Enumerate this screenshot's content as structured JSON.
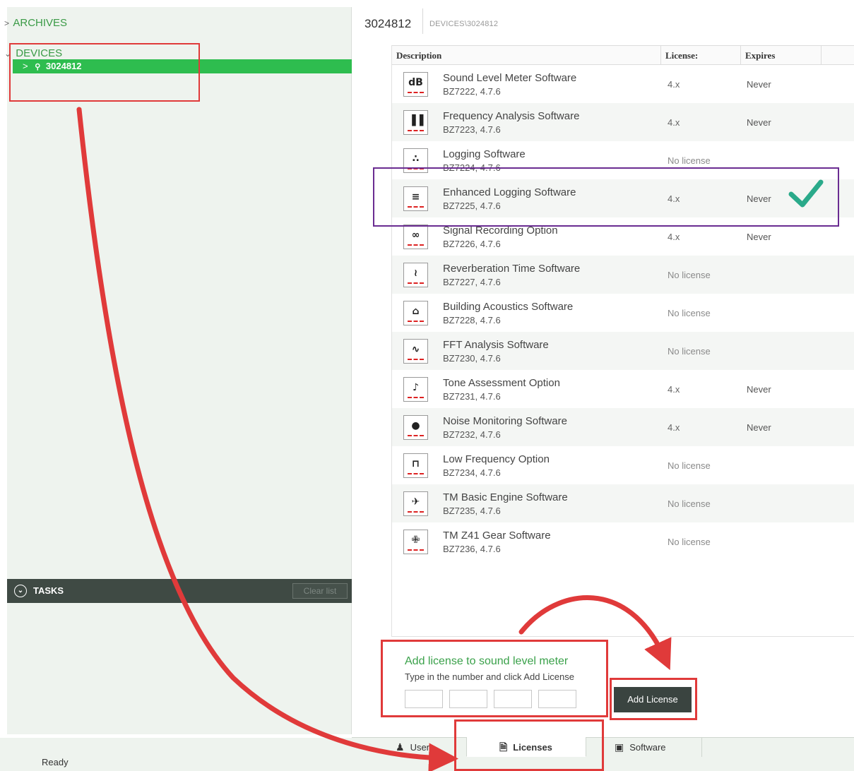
{
  "tree": {
    "archives": "ARCHIVES",
    "devices": "DEVICES",
    "device_id": "3024812"
  },
  "tasks": {
    "label": "TASKS",
    "clear_label": "Clear list"
  },
  "header": {
    "title": "3024812",
    "breadcrumb": "DEVICES\\3024812"
  },
  "table": {
    "columns": [
      "Description",
      "License:",
      "Expires"
    ],
    "rows": [
      {
        "icon": "db-icon",
        "name": "Sound Level Meter Software",
        "code": "BZ7222, 4.7.6",
        "license": "4.x",
        "expires": "Never"
      },
      {
        "icon": "frequency-bars-icon",
        "name": "Frequency Analysis Software",
        "code": "BZ7223, 4.7.6",
        "license": "4.x",
        "expires": "Never"
      },
      {
        "icon": "logging-icon",
        "name": "Logging Software",
        "code": "BZ7224, 4.7.6",
        "license": "No license",
        "expires": ""
      },
      {
        "icon": "enhanced-logging-icon",
        "name": "Enhanced Logging Software",
        "code": "BZ7225, 4.7.6",
        "license": "4.x",
        "expires": "Never"
      },
      {
        "icon": "tape-recording-icon",
        "name": "Signal Recording Option",
        "code": "BZ7226, 4.7.6",
        "license": "4.x",
        "expires": "Never"
      },
      {
        "icon": "reverberation-icon",
        "name": "Reverberation Time Software",
        "code": "BZ7227, 4.7.6",
        "license": "No license",
        "expires": ""
      },
      {
        "icon": "house-icon",
        "name": "Building Acoustics Software",
        "code": "BZ7228, 4.7.6",
        "license": "No license",
        "expires": ""
      },
      {
        "icon": "fft-spectrum-icon",
        "name": "FFT Analysis Software",
        "code": "BZ7230, 4.7.6",
        "license": "No license",
        "expires": ""
      },
      {
        "icon": "music-note-icon",
        "name": "Tone Assessment Option",
        "code": "BZ7231, 4.7.6",
        "license": "4.x",
        "expires": "Never"
      },
      {
        "icon": "noise-monitor-icon",
        "name": "Noise Monitoring Software",
        "code": "BZ7232, 4.7.6",
        "license": "4.x",
        "expires": "Never"
      },
      {
        "icon": "low-frequency-icon",
        "name": "Low Frequency Option",
        "code": "BZ7234, 4.7.6",
        "license": "No license",
        "expires": ""
      },
      {
        "icon": "helicopter-icon",
        "name": "TM Basic Engine Software",
        "code": "BZ7235, 4.7.6",
        "license": "No license",
        "expires": ""
      },
      {
        "icon": "helicopter-gear-icon",
        "name": "TM Z41 Gear Software",
        "code": "BZ7236, 4.7.6",
        "license": "No license",
        "expires": ""
      }
    ]
  },
  "add_license": {
    "title": "Add license to sound level meter",
    "subtitle": "Type in the number and click Add License",
    "button_label": "Add License"
  },
  "tabs": [
    {
      "label": "Users",
      "icon": "user-icon"
    },
    {
      "label": "Licenses",
      "icon": "license-icon"
    },
    {
      "label": "Software",
      "icon": "software-icon"
    }
  ],
  "status": "Ready",
  "colors": {
    "accent_green": "#2ebd4f",
    "annotation_red": "#e03a3a",
    "annotation_purple": "#6a2c91",
    "check_teal": "#2aaa8a"
  }
}
